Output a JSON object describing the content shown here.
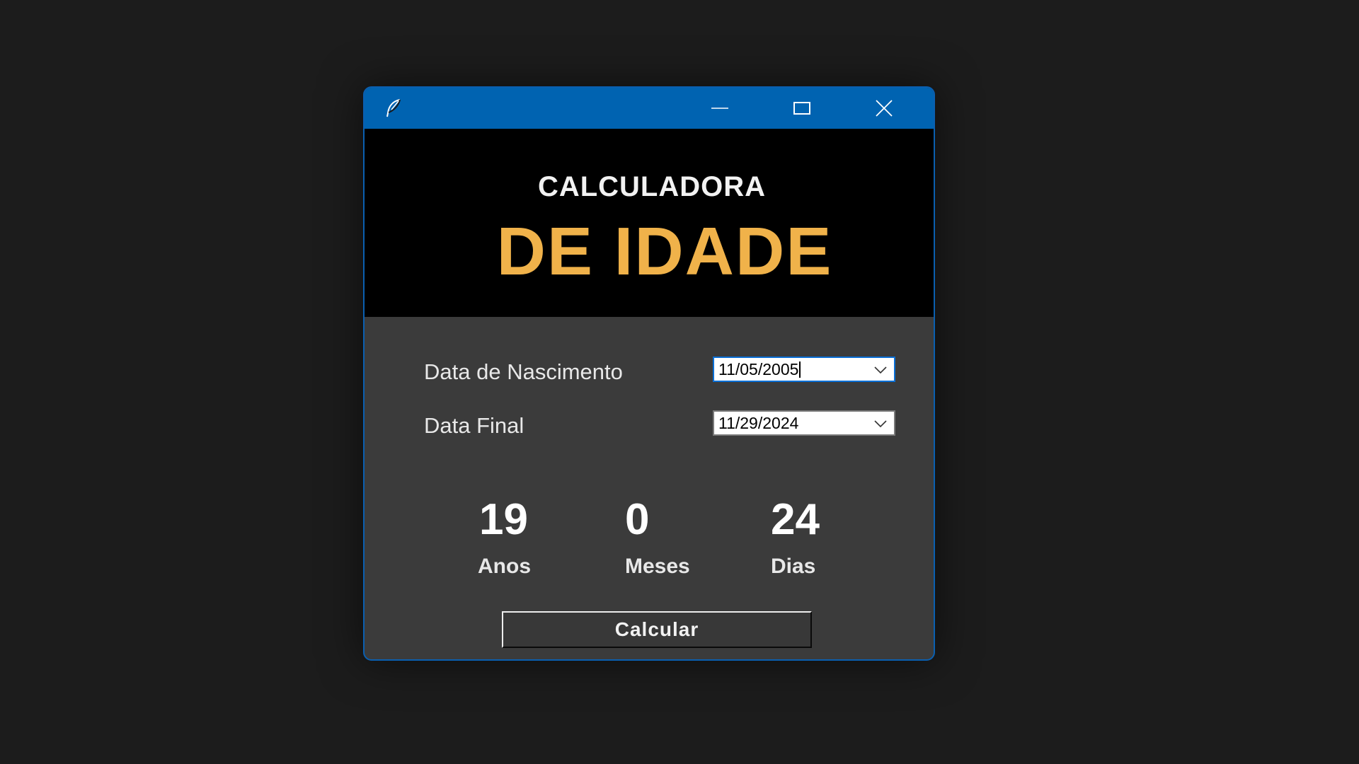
{
  "window": {
    "controls": {
      "minimize_icon": "minimize-icon",
      "maximize_icon": "maximize-icon",
      "close_icon": "close-icon"
    },
    "app_icon": "feather-icon",
    "titlebar_color": "#0063b1"
  },
  "header": {
    "title_line1": "CALCULADORA",
    "title_line2": "DE IDADE",
    "title_line2_color": "#f0b24a"
  },
  "form": {
    "birth_label": "Data de Nascimento",
    "birth_value": "11/05/2005",
    "final_label": "Data Final",
    "final_value": "11/29/2024"
  },
  "result": {
    "years": "19",
    "years_label": "Anos",
    "months": "0",
    "months_label": "Meses",
    "days": "24",
    "days_label": "Dias"
  },
  "actions": {
    "calculate_label": "Calcular"
  }
}
